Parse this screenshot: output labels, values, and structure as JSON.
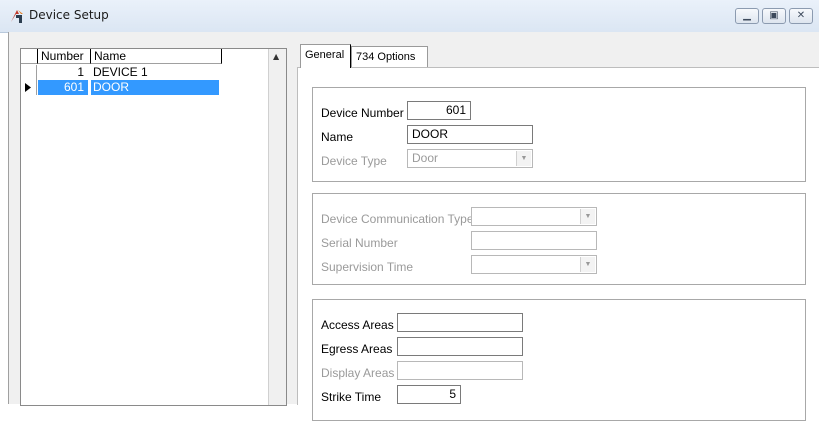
{
  "window": {
    "title": "Device Setup"
  },
  "grid": {
    "columns": [
      "Number",
      "Name"
    ],
    "rows": [
      {
        "number": "1",
        "name": "DEVICE 1",
        "selected": false
      },
      {
        "number": "601",
        "name": "DOOR",
        "selected": true
      }
    ]
  },
  "tabs": [
    {
      "label": "General",
      "active": true
    },
    {
      "label": "734 Options",
      "active": false
    }
  ],
  "general": {
    "device_number_label": "Device Number",
    "device_number": "601",
    "name_label": "Name",
    "name": "DOOR",
    "device_type_label": "Device Type",
    "device_type": "Door",
    "comm_type_label": "Device Communication Type",
    "comm_type": "",
    "serial_label": "Serial Number",
    "serial": "",
    "supervision_label": "Supervision Time",
    "supervision": "",
    "access_label": "Access Areas",
    "access": "",
    "egress_label": "Egress Areas",
    "egress": "",
    "display_label": "Display Areas",
    "display": "",
    "strike_label": "Strike Time",
    "strike": "5"
  },
  "colors": {
    "selection": "#3399ff",
    "disabled_text": "#9a9a9a"
  }
}
